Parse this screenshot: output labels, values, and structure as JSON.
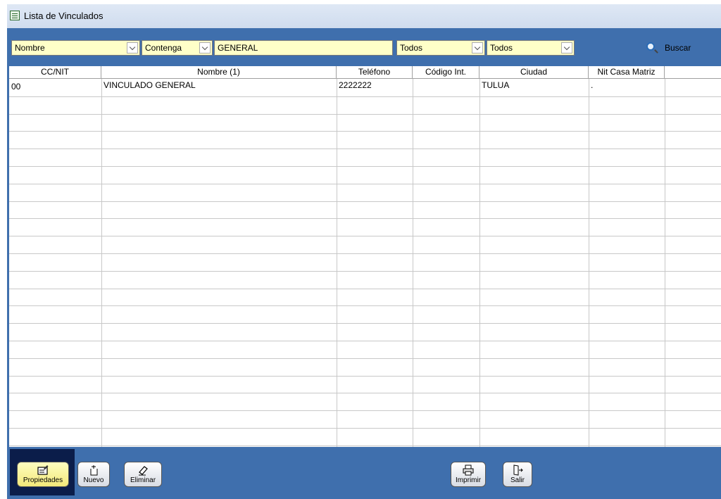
{
  "window": {
    "title": "Lista de Vinculados"
  },
  "filters": {
    "field": "Nombre",
    "operator": "Contenga",
    "value": "GENERAL",
    "filter3": "Todos",
    "filter4": "Todos",
    "search_label": "Buscar"
  },
  "table": {
    "columns": [
      "CC/NIT",
      "Nombre (1)",
      "Teléfono",
      "Código Int.",
      "Ciudad",
      "Nit Casa Matriz"
    ],
    "rows": [
      [
        "00",
        "VINCULADO GENERAL",
        "2222222",
        "",
        "TULUA",
        "."
      ]
    ]
  },
  "buttons": {
    "propiedades": "Propiedades",
    "nuevo": "Nuevo",
    "eliminar": "Eliminar",
    "imprimir": "Imprimir",
    "salir": "Salir"
  },
  "icons": {
    "title": "list-window-icon",
    "search": "magnifier-icon",
    "propiedades": "edit-card-icon",
    "nuevo": "new-document-icon",
    "eliminar": "eraser-icon",
    "imprimir": "printer-icon",
    "salir": "exit-door-icon"
  },
  "colors": {
    "frame": "#3f6fad",
    "input_bg": "#ffffc8",
    "titlebar": "#dfe8f5",
    "selected_button_frame": "#0b1d4a"
  }
}
